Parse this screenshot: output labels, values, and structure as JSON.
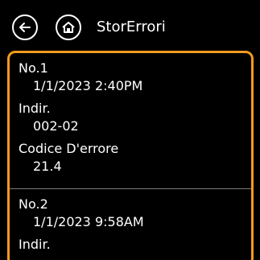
{
  "header": {
    "title": "StorErrori",
    "back_icon": "arrow-left-icon",
    "home_icon": "home-icon"
  },
  "colors": {
    "background": "#000000",
    "text": "#ffffff",
    "panel_border": "#f39a1f",
    "divider": "#7a7a7a"
  },
  "entries": [
    {
      "number": "No.1",
      "datetime": "1/1/2023 2:40PM",
      "address_label": "Indir.",
      "address": "002-02",
      "code_label": "Codice D'errore",
      "code": "21.4"
    },
    {
      "number": "No.2",
      "datetime": "1/1/2023 9:58AM",
      "address_label": "Indir.",
      "address": "",
      "code_label": "",
      "code": ""
    }
  ]
}
